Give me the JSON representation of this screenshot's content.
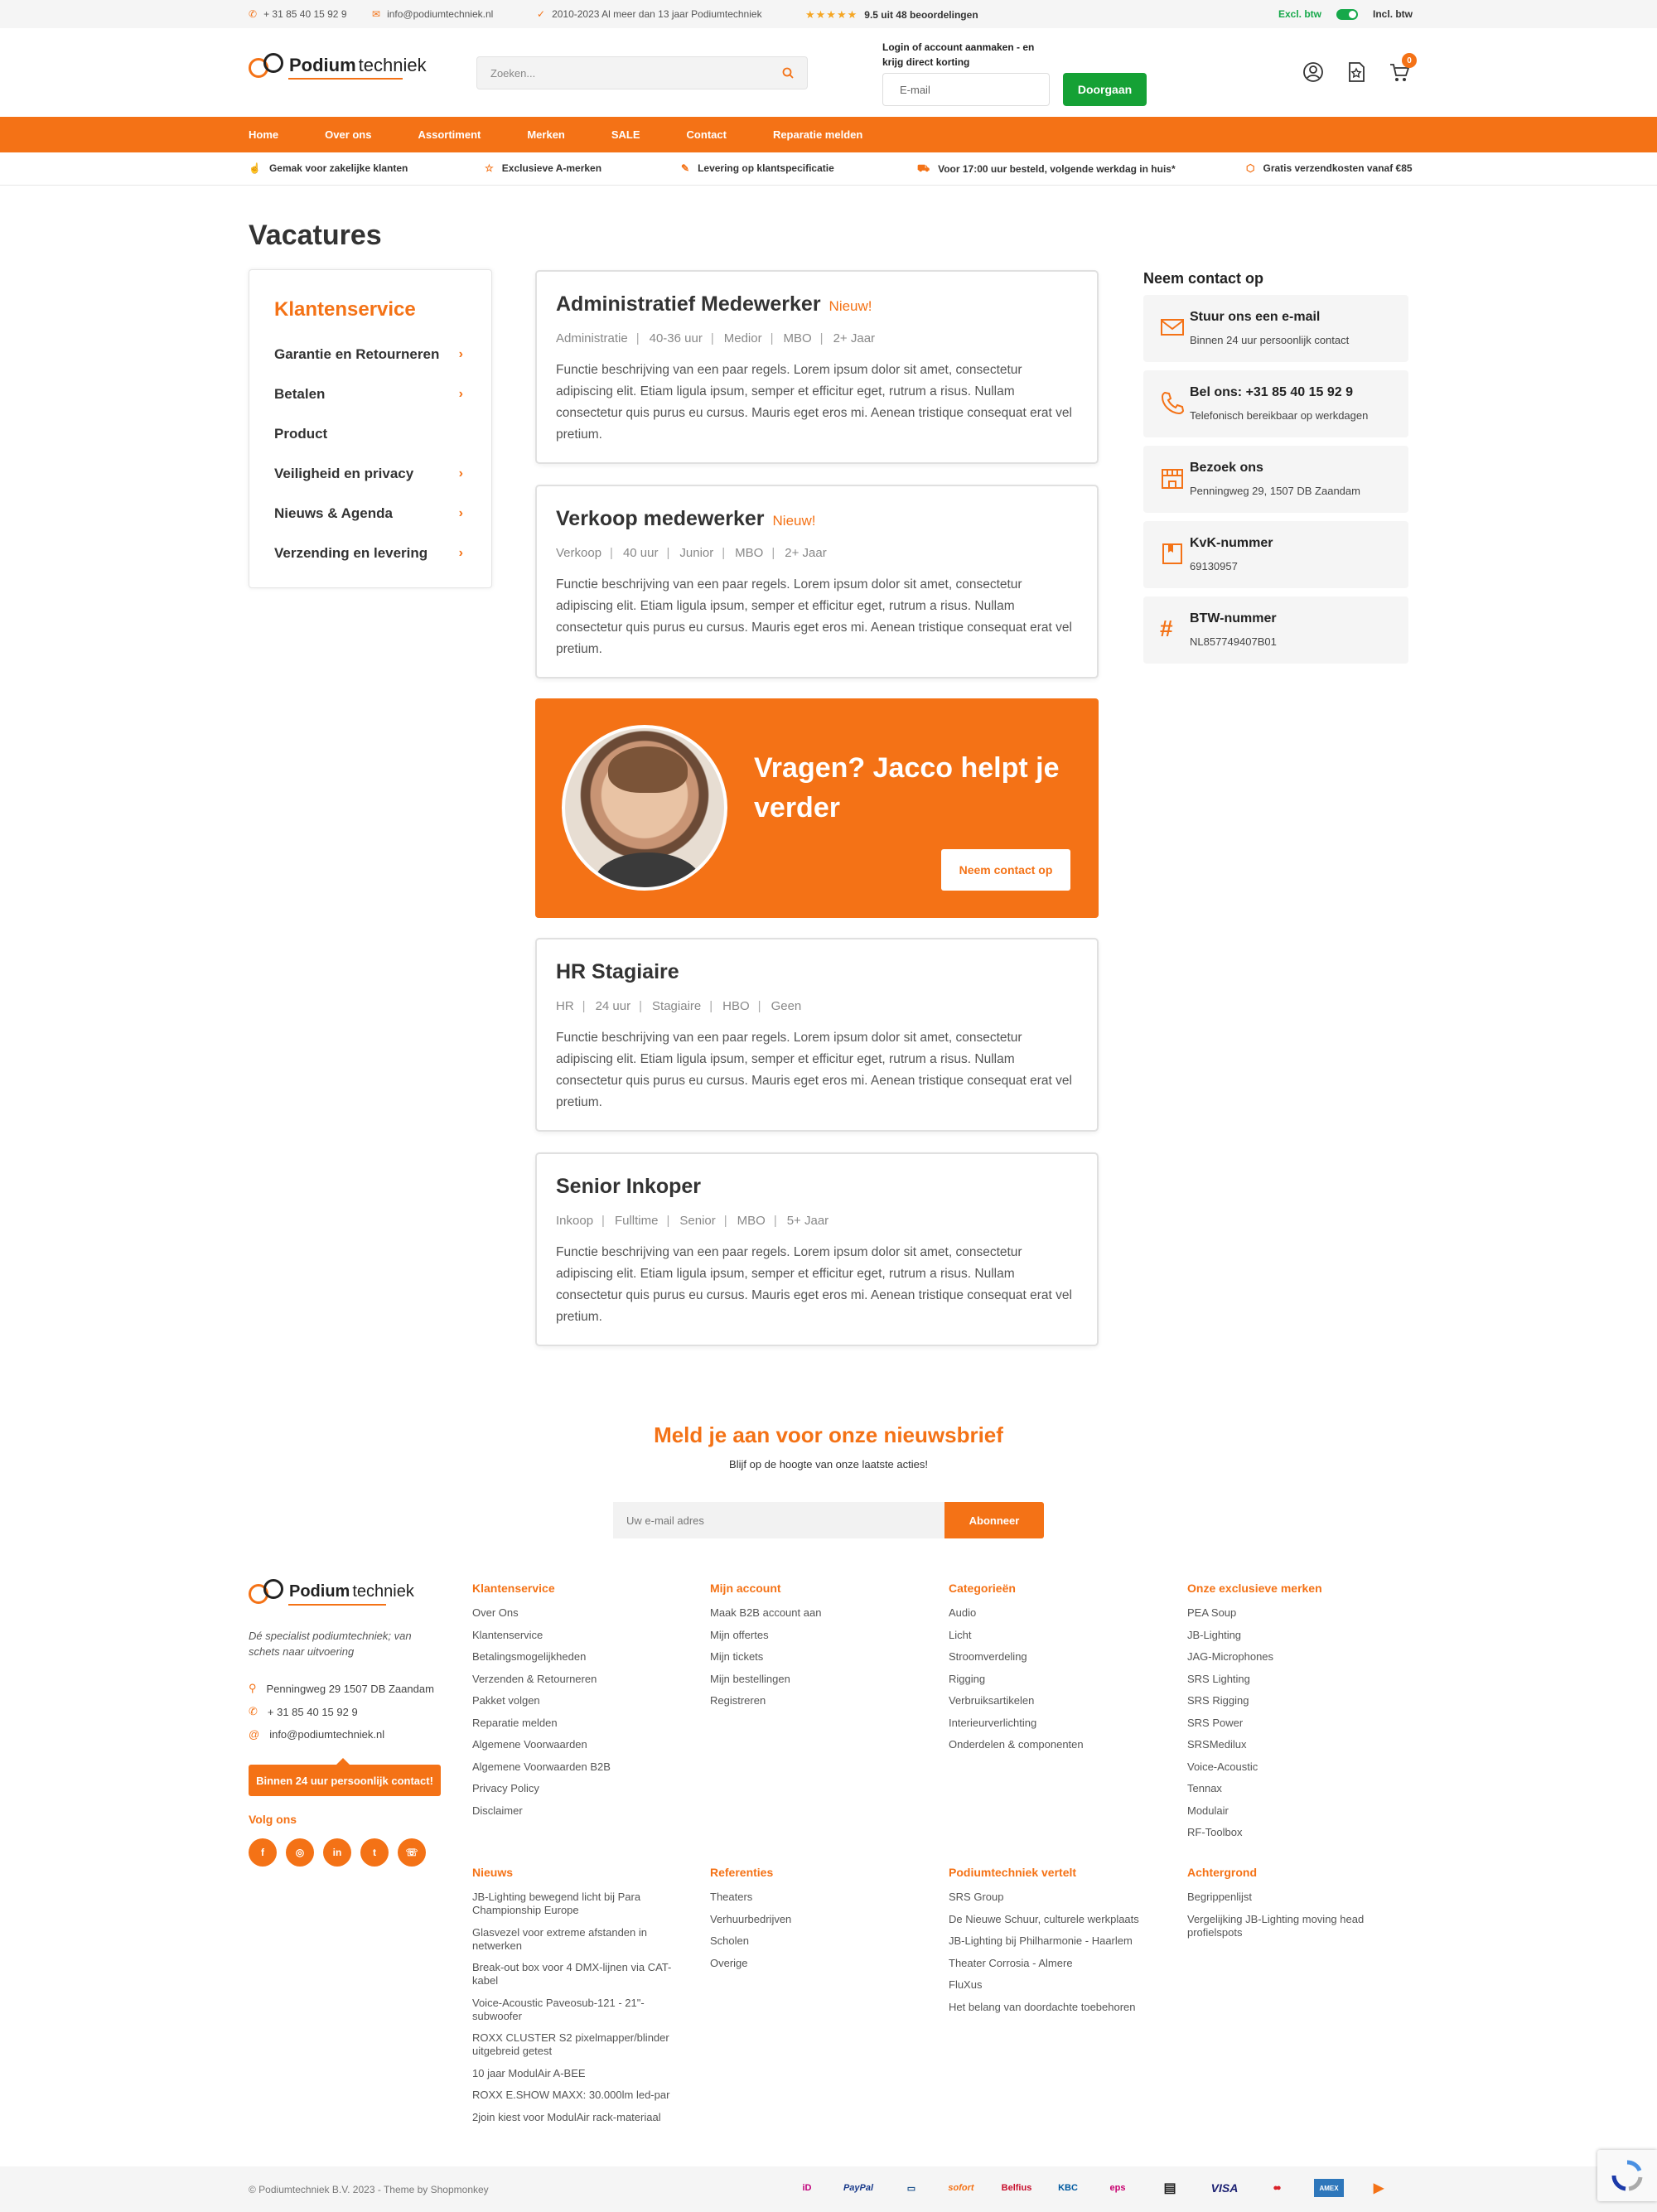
{
  "topbar": {
    "phone": "+ 31 85 40 15 92 9",
    "email": "info@podiumtechniek.nl",
    "since": "2010-2023 Al meer dan 13 jaar Podiumtechniek",
    "rating": "9.5 uit 48 beoordelingen",
    "excl": "Excl. btw",
    "incl": "Incl. btw",
    "stars": "★★★★★"
  },
  "header": {
    "logo_a": "Podium",
    "logo_b": "techniek",
    "search_placeholder": "Zoeken...",
    "login_line1": "Login of account aanmaken - en",
    "login_line2": "krijg direct korting",
    "email_placeholder": "E-mail",
    "continue": "Doorgaan",
    "cart_count": "0"
  },
  "nav": [
    "Home",
    "Over ons",
    "Assortiment",
    "Merken",
    "SALE",
    "Contact",
    "Reparatie melden"
  ],
  "usps": [
    "Gemak voor zakelijke klanten",
    "Exclusieve A-merken",
    "Levering op klantspecificatie",
    "Voor 17:00 uur besteld, volgende werkdag in huis*",
    "Gratis verzendkosten vanaf €85"
  ],
  "page_title": "Vacatures",
  "sidebar": {
    "title": "Klantenservice",
    "items": [
      "Garantie en Retourneren",
      "Betalen",
      "Product",
      "Veiligheid en privacy",
      "Nieuws & Agenda",
      "Verzending en levering"
    ]
  },
  "jobs": [
    {
      "title": "Administratief Medewerker",
      "badge": "Nieuw!",
      "meta": [
        "Administratie",
        "40-36 uur",
        "Medior",
        "MBO",
        "2+ Jaar"
      ],
      "desc": "Functie beschrijving van een paar regels. Lorem ipsum dolor sit amet, consectetur adipiscing elit. Etiam ligula ipsum, semper et efficitur eget, rutrum a risus. Nullam consectetur quis purus eu cursus. Mauris eget eros mi. Aenean tristique consequat erat vel pretium."
    },
    {
      "title": "Verkoop medewerker",
      "badge": "Nieuw!",
      "meta": [
        "Verkoop",
        "40 uur",
        "Junior",
        "MBO",
        "2+ Jaar"
      ],
      "desc": "Functie beschrijving van een paar regels. Lorem ipsum dolor sit amet, consectetur adipiscing elit. Etiam ligula ipsum, semper et efficitur eget, rutrum a risus. Nullam consectetur quis purus eu cursus. Mauris eget eros mi. Aenean tristique consequat erat vel pretium."
    },
    {
      "title": "HR Stagiaire",
      "badge": "",
      "meta": [
        "HR",
        "24 uur",
        "Stagiaire",
        "HBO",
        "Geen"
      ],
      "desc": "Functie beschrijving van een paar regels. Lorem ipsum dolor sit amet, consectetur adipiscing elit. Etiam ligula ipsum, semper et efficitur eget, rutrum a risus. Nullam consectetur quis purus eu cursus. Mauris eget eros mi. Aenean tristique consequat erat vel pretium."
    },
    {
      "title": "Senior Inkoper",
      "badge": "",
      "meta": [
        "Inkoop",
        "Fulltime",
        "Senior",
        "MBO",
        "5+ Jaar"
      ],
      "desc": "Functie beschrijving van een paar regels. Lorem ipsum dolor sit amet, consectetur adipiscing elit. Etiam ligula ipsum, semper et efficitur eget, rutrum a risus. Nullam consectetur quis purus eu cursus. Mauris eget eros mi. Aenean tristique consequat erat vel pretium."
    }
  ],
  "promo": {
    "title": "Vragen? Jacco helpt je verder",
    "button": "Neem contact op"
  },
  "contact": {
    "heading": "Neem contact op",
    "items": [
      {
        "title": "Stuur ons een e-mail",
        "sub": "Binnen 24 uur persoonlijk contact"
      },
      {
        "title": "Bel ons: +31 85 40 15 92 9",
        "sub": "Telefonisch bereikbaar op werkdagen"
      },
      {
        "title": "Bezoek ons",
        "sub": "Penningweg 29, 1507 DB Zaandam"
      },
      {
        "title": "KvK-nummer",
        "sub": "69130957"
      },
      {
        "title": "BTW-nummer",
        "sub": "NL857749407B01"
      }
    ]
  },
  "newsletter": {
    "title": "Meld je aan voor onze nieuwsbrief",
    "sub": "Blijf op de hoogte van onze laatste acties!",
    "placeholder": "Uw e-mail adres",
    "button": "Abonneer"
  },
  "footer": {
    "tagline": "Dé specialist podiumtechniek; van schets naar uitvoering",
    "address": "Penningweg 29  1507 DB Zaandam",
    "phone": "+ 31 85 40 15 92 9",
    "email": "info@podiumtechniek.nl",
    "contact_btn": "Binnen 24 uur persoonlijk contact!",
    "follow": "Volg ons",
    "social": [
      "f",
      "◎",
      "in",
      "t",
      "☏"
    ],
    "cols": [
      {
        "title": "Klantenservice",
        "links": [
          "Over Ons",
          "Klantenservice",
          "Betalingsmogelijkheden",
          "Verzenden & Retourneren",
          "Pakket volgen",
          "Reparatie melden",
          "Algemene Voorwaarden",
          "Algemene Voorwaarden B2B",
          "Privacy Policy",
          "Disclaimer"
        ]
      },
      {
        "title": "Mijn account",
        "links": [
          "Maak B2B account aan",
          "Mijn offertes",
          "Mijn tickets",
          "Mijn bestellingen",
          "Registreren"
        ]
      },
      {
        "title": "Categorieën",
        "links": [
          "Audio",
          "Licht",
          "Stroomverdeling",
          "Rigging",
          "Verbruiksartikelen",
          "Interieurverlichting",
          "Onderdelen & componenten"
        ]
      },
      {
        "title": "Onze exclusieve merken",
        "links": [
          "PEA Soup",
          "JB-Lighting",
          "JAG-Microphones",
          "SRS Lighting",
          "SRS Rigging",
          "SRS Power",
          "SRSMedilux",
          "Voice-Acoustic",
          "Tennax",
          "Modulair",
          "RF-Toolbox"
        ]
      }
    ],
    "cols2": [
      {
        "title": "Nieuws",
        "links": [
          "JB-Lighting bewegend licht bij Para Championship Europe",
          "Glasvezel voor extreme afstanden in netwerken",
          "Break-out box voor 4 DMX-lijnen via CAT-kabel",
          "Voice-Acoustic Paveosub-121 - 21\"-subwoofer",
          "ROXX CLUSTER S2 pixelmapper/blinder uitgebreid getest",
          "10 jaar ModulAir A-BEE",
          "ROXX E.SHOW MAXX: 30.000lm led-par",
          "2join kiest voor ModulAir rack-materiaal"
        ]
      },
      {
        "title": "Referenties",
        "links": [
          "Theaters",
          "Verhuurbedrijven",
          "Scholen",
          "Overige"
        ]
      },
      {
        "title": "Podiumtechniek vertelt",
        "links": [
          "SRS Group",
          "De Nieuwe Schuur, culturele werkplaats",
          "JB-Lighting bij Philharmonie - Haarlem",
          "Theater Corrosia - Almere",
          "FluXus",
          "Het belang van doordachte toebehoren"
        ]
      },
      {
        "title": "Achtergrond",
        "links": [
          "Begrippenlijst",
          "Vergelijking JB-Lighting moving head profielspots"
        ]
      }
    ],
    "copyright": "© Podiumtechniek B.V. 2023 - Theme by Shopmonkey",
    "payments": [
      "iD",
      "PayPal",
      "▭",
      "sofort",
      "Belfius",
      "KBC",
      "eps",
      "▤",
      "VISA",
      "●●",
      "AMEX",
      "▶"
    ]
  }
}
